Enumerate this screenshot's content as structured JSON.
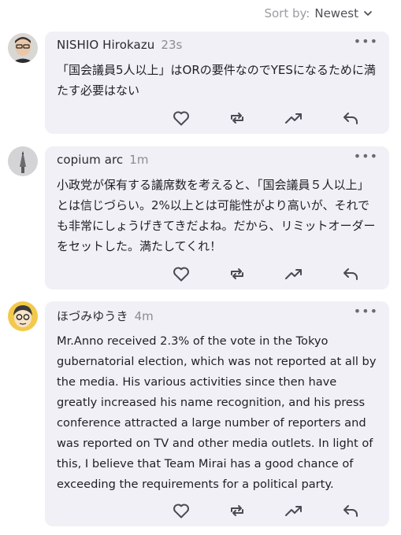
{
  "sort": {
    "label": "Sort by:",
    "value": "Newest"
  },
  "comments": [
    {
      "author": "NISHIO Hirokazu",
      "time": "23s",
      "text": "「国会議員5人以上」はORの要件なのでYESになるために満たす必要はない"
    },
    {
      "author": "copium arc",
      "time": "1m",
      "text": "小政党が保有する議席数を考えると、「国会議員５人以上」とは信じづらい。2%以上とは可能性がより高いが、それでも非常にしょうげきてきだよね。だから、リミットオーダーをセットした。満たしてくれ！"
    },
    {
      "author": "ほづみゆうき",
      "time": "4m",
      "text": "Mr.Anno received 2.3% of the vote in the Tokyo gubernatorial election, which was not reported at all by the media. His various activities since then have greatly increased his name recognition, and his press conference attracted a large number of reporters and was reported on TV and other media outlets. In light of this, I believe that Team Mirai has a good chance of exceeding the requirements for a political party."
    }
  ],
  "icons": {
    "more": "more-horizontal-icon",
    "like": "heart-icon",
    "repost": "repost-icon",
    "trend": "trending-up-icon",
    "reply": "reply-icon",
    "sort": "chevron-down-icon"
  },
  "colors": {
    "card": "#f1f0f6",
    "muted": "#8b8b94",
    "icon": "#4a4a55"
  }
}
